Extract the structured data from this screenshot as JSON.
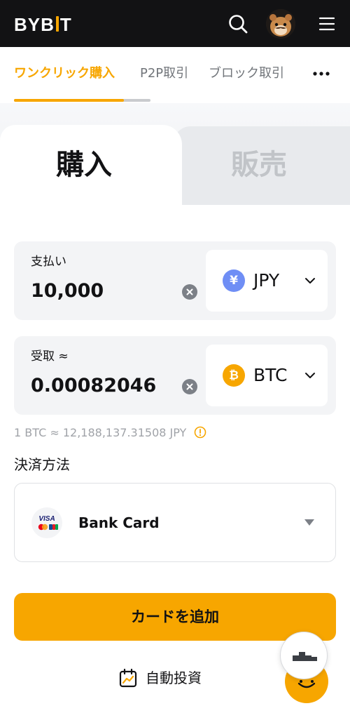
{
  "header": {
    "logo_left": "BYB",
    "logo_right": "T",
    "icons": [
      "search-icon",
      "avatar",
      "hamburger-menu-icon"
    ]
  },
  "tabs": {
    "active": "ワンクリック購入",
    "p2p": "P2P取引",
    "block": "ブロック取引",
    "more_icon": "more-dots-icon",
    "accent": "#f7a600"
  },
  "trade_tabs": {
    "buy": "購入",
    "sell": "販売"
  },
  "pay": {
    "label": "支払い",
    "amount": "10,000",
    "currency": "JPY",
    "currency_symbol": "¥",
    "icon_color": "#6f8ef5"
  },
  "receive": {
    "label": "受取 ≈",
    "amount": "0.00082046",
    "currency": "BTC",
    "currency_symbol": "₿",
    "icon_color": "#f7a600"
  },
  "rate": "1 BTC ≈ 12,188,137.31508 JPY",
  "payment": {
    "title": "決済方法",
    "method": "Bank Card",
    "logo_visa": "VISA"
  },
  "cta": "カードを追加",
  "auto_invest": "自動投資"
}
